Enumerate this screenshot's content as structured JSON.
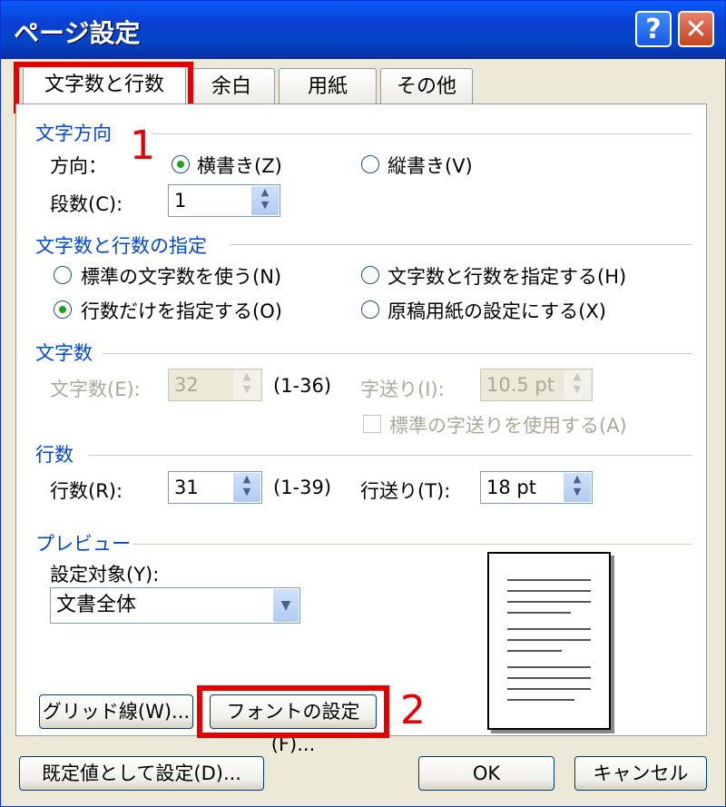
{
  "window": {
    "title": "ページ設定"
  },
  "tabs": [
    "文字数と行数",
    "余白",
    "用紙",
    "その他"
  ],
  "annotations": {
    "step1": "1",
    "step2": "2"
  },
  "direction_group": {
    "title": "文字方向",
    "direction_label": "方向：",
    "horizontal": "横書き(Z)",
    "vertical": "縦書き(V)",
    "columns_label": "段数(C):",
    "columns_value": "1"
  },
  "count_group": {
    "title": "文字数と行数の指定",
    "opt_standard": "標準の文字数を使う(N)",
    "opt_both": "文字数と行数を指定する(H)",
    "opt_lines_only": "行数だけを指定する(O)",
    "opt_manuscript": "原稿用紙の設定にする(X)"
  },
  "chars_group": {
    "title": "文字数",
    "chars_label": "文字数(E):",
    "chars_value": "32",
    "chars_range": "(1-36)",
    "pitch_label": "字送り(I):",
    "pitch_value": "10.5 pt",
    "standard_pitch": "標準の字送りを使用する(A)"
  },
  "lines_group": {
    "title": "行数",
    "lines_label": "行数(R):",
    "lines_value": "31",
    "lines_range": "(1-39)",
    "pitch_label": "行送り(T):",
    "pitch_value": "18 pt"
  },
  "preview_group": {
    "title": "プレビュー",
    "apply_label": "設定対象(Y):",
    "apply_value": "文書全体"
  },
  "buttons": {
    "grid": "グリッド線(W)...",
    "font": "フォントの設定(F)...",
    "default": "既定値として設定(D)...",
    "ok": "OK",
    "cancel": "キャンセル"
  },
  "colors": {
    "accent_blue": "#0046d5",
    "highlight_red": "#e60000"
  }
}
